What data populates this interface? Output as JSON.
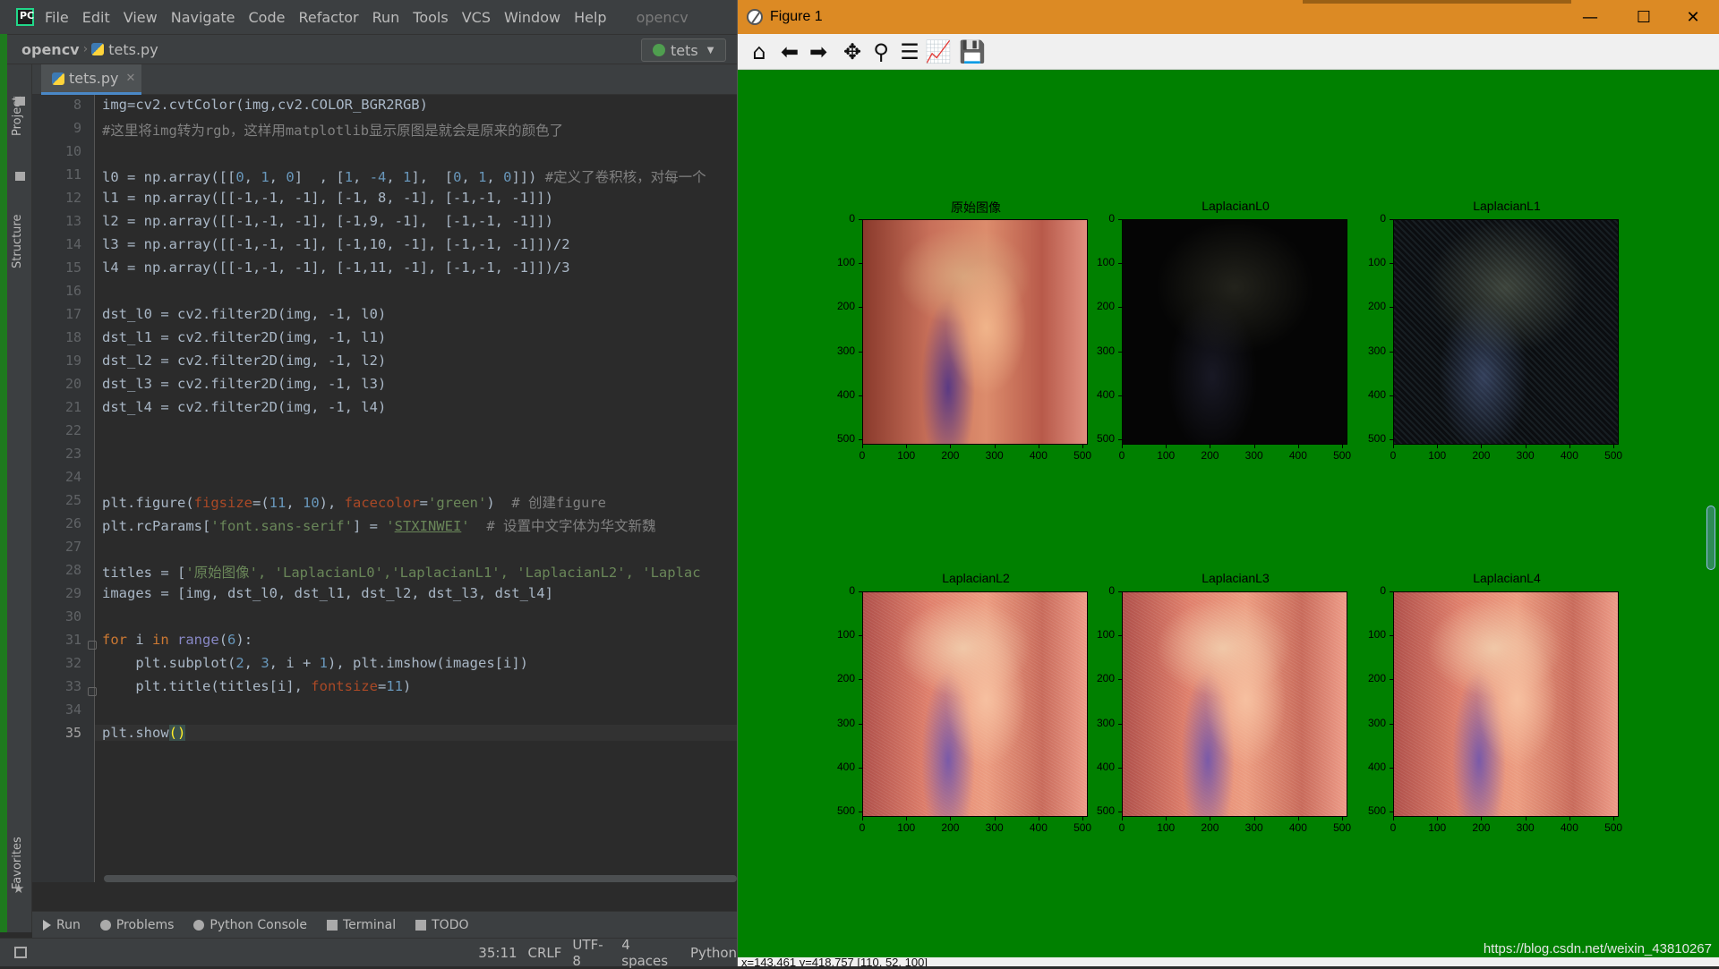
{
  "ide": {
    "menu": [
      "File",
      "Edit",
      "View",
      "Navigate",
      "Code",
      "Refactor",
      "Run",
      "Tools",
      "VCS",
      "Window",
      "Help"
    ],
    "window_title": "opencv",
    "breadcrumb": {
      "project": "opencv",
      "file": "tets.py"
    },
    "run_config": "tets",
    "left_tabs": {
      "project": "Project",
      "structure": "Structure",
      "favorites": "Favorites"
    },
    "editor_tab": "tets.py",
    "line_numbers": [
      "8",
      "9",
      "10",
      "11",
      "12",
      "13",
      "14",
      "15",
      "16",
      "17",
      "18",
      "19",
      "20",
      "21",
      "22",
      "23",
      "24",
      "25",
      "26",
      "27",
      "28",
      "29",
      "30",
      "31",
      "32",
      "33",
      "34",
      "35"
    ],
    "code": {
      "l8": "img=cv2.cvtColor(img,cv2.COLOR_BGR2RGB)",
      "l9": "#这里将img转为rgb，这样用matplotlib显示原图是就会是原来的颜色了",
      "l11_code": "l0 = np.array([[",
      "l11_a": "0",
      "l11_b": "1",
      "l11_c": "0",
      "l11_d": "1",
      "l11_e": "-4",
      "l11_f": "1",
      "l11_g": "0",
      "l11_h": "1",
      "l11_i": "0",
      "l11_comment": "#定义了卷积核，对每一个",
      "l12": "l1 = np.array([[-1,-1, -1], [-1, 8, -1], [-1,-1, -1]])",
      "l13": "l2 = np.array([[-1,-1, -1], [-1,9, -1],  [-1,-1, -1]])",
      "l14": "l3 = np.array([[-1,-1, -1], [-1,10, -1], [-1,-1, -1]])/2",
      "l15": "l4 = np.array([[-1,-1, -1], [-1,11, -1], [-1,-1, -1]])/3",
      "l17": "dst_l0 = cv2.filter2D(img, -1, l0)",
      "l18": "dst_l1 = cv2.filter2D(img, -1, l1)",
      "l19": "dst_l2 = cv2.filter2D(img, -1, l2)",
      "l20": "dst_l3 = cv2.filter2D(img, -1, l3)",
      "l21": "dst_l4 = cv2.filter2D(img, -1, l4)",
      "l25_a": "plt.figure(",
      "l25_kw1": "figsize",
      "l25_b": "=(",
      "l25_n1": "11",
      "l25_c": ", ",
      "l25_n2": "10",
      "l25_d": "), ",
      "l25_kw2": "facecolor",
      "l25_e": "=",
      "l25_s": "'green'",
      "l25_f": ")  ",
      "l25_com": "# 创建figure",
      "l26_a": "plt.rcParams[",
      "l26_s1": "'font.sans-serif'",
      "l26_b": "] = ",
      "l26_s2": "'",
      "l26_s3": "STXINWEI",
      "l26_s4": "'",
      "l26_c": "  ",
      "l26_com": "# 设置中文字体为华文新魏",
      "l28_a": "titles = [",
      "l28_s": "'原始图像', 'LaplacianL0','LaplacianL1', 'LaplacianL2', 'Laplac",
      "l29": "images = [img, dst_l0, dst_l1, dst_l2, dst_l3, dst_l4]",
      "l31_kw": "for",
      "l31_a": " i ",
      "l31_kw2": "in",
      "l31_sp": " ",
      "l31_bi": "range",
      "l31_b": "(",
      "l31_n": "6",
      "l31_c": "):",
      "l32_a": "    plt.subplot(",
      "l32_n1": "2",
      "l32_b": ", ",
      "l32_n2": "3",
      "l32_c": ", i + ",
      "l32_n3": "1",
      "l32_d": "), plt.imshow(images[i])",
      "l33_a": "    plt.title(titles[i], ",
      "l33_kw": "fontsize",
      "l33_b": "=",
      "l33_n": "11",
      "l33_c": ")",
      "l35_a": "plt.show",
      "l35_p": "()"
    },
    "toolwindows": [
      "Run",
      "Problems",
      "Python Console",
      "Terminal",
      "TODO"
    ],
    "status": {
      "position": "35:11",
      "line_sep": "CRLF",
      "encoding": "UTF-8",
      "indent": "4 spaces",
      "interpreter": "Python"
    }
  },
  "figure": {
    "title": "Figure 1",
    "toolbar": {
      "home": "home-icon",
      "back": "back-arrow-icon",
      "forward": "forward-arrow-icon",
      "pan": "pan-icon",
      "zoom": "zoom-icon",
      "subplots": "configure-subplots-icon",
      "edit": "edit-axis-icon",
      "save": "save-icon"
    },
    "window_controls": {
      "minimize": "—",
      "maximize": "☐",
      "close": "✕"
    },
    "facecolor": "#008000",
    "subplots": [
      {
        "title": "原始图像",
        "image": "original"
      },
      {
        "title": "LaplacianL0",
        "image": "dark-edges"
      },
      {
        "title": "LaplacianL1",
        "image": "dark-edges-bright"
      },
      {
        "title": "LaplacianL2",
        "image": "sharpened"
      },
      {
        "title": "LaplacianL3",
        "image": "sharpened"
      },
      {
        "title": "LaplacianL4",
        "image": "sharpened"
      }
    ],
    "axis_ticks": {
      "y": [
        "0",
        "100",
        "200",
        "300",
        "400",
        "500"
      ],
      "x": [
        "0",
        "100",
        "200",
        "300",
        "400",
        "500"
      ]
    },
    "watermark": "https://blog.csdn.net/weixin_43810267",
    "coord_readout": "x=143.461    y=418.757    [110, 52, 100]"
  }
}
